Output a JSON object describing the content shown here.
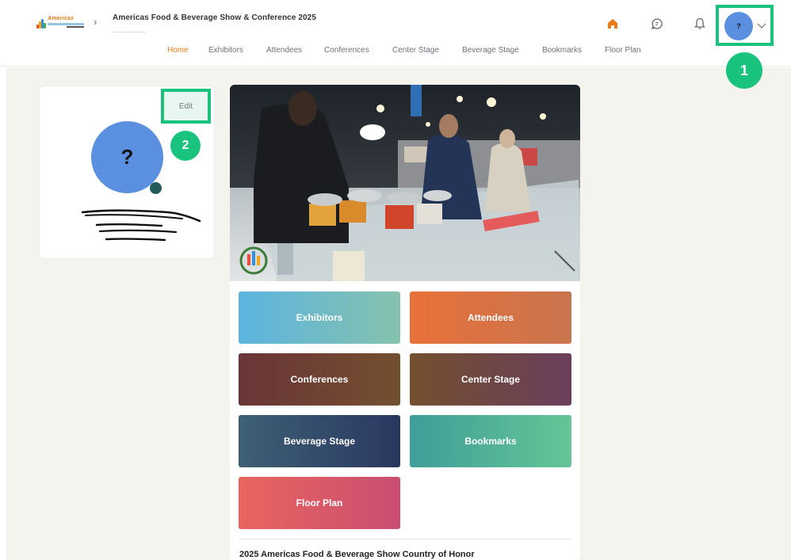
{
  "header": {
    "logo_text": "Americas",
    "event_title": "Americas Food & Beverage Show & Conference 2025",
    "avatar_initial": "?"
  },
  "nav": {
    "items": [
      {
        "label": "Home",
        "active": true
      },
      {
        "label": "Exhibitors",
        "active": false
      },
      {
        "label": "Attendees",
        "active": false
      },
      {
        "label": "Conferences",
        "active": false
      },
      {
        "label": "Center Stage",
        "active": false
      },
      {
        "label": "Beverage Stage",
        "active": false
      },
      {
        "label": "Bookmarks",
        "active": false
      },
      {
        "label": "Floor Plan",
        "active": false
      }
    ]
  },
  "annotations": {
    "badge_1": "1",
    "badge_2": "2"
  },
  "profile": {
    "edit_label": "Edit",
    "avatar_initial": "?"
  },
  "tiles": {
    "exhibitors": "Exhibitors",
    "attendees": "Attendees",
    "conferences": "Conferences",
    "center_stage": "Center Stage",
    "beverage_stage": "Beverage Stage",
    "bookmarks": "Bookmarks",
    "floor_plan": "Floor Plan"
  },
  "section": {
    "honor_title": "2025 Americas Food & Beverage Show Country of Honor"
  },
  "icons": {
    "home": "home-icon",
    "chat": "chat-icon",
    "notifications": "bell-icon",
    "caret": "chevron-down-icon",
    "breadcrumb": "chevron-right-icon"
  },
  "colors": {
    "accent": "#f07a12",
    "highlight": "#19c37d",
    "avatar": "#5b8fe0",
    "status": "#245a5a",
    "page_background": "#f4f3ee"
  }
}
